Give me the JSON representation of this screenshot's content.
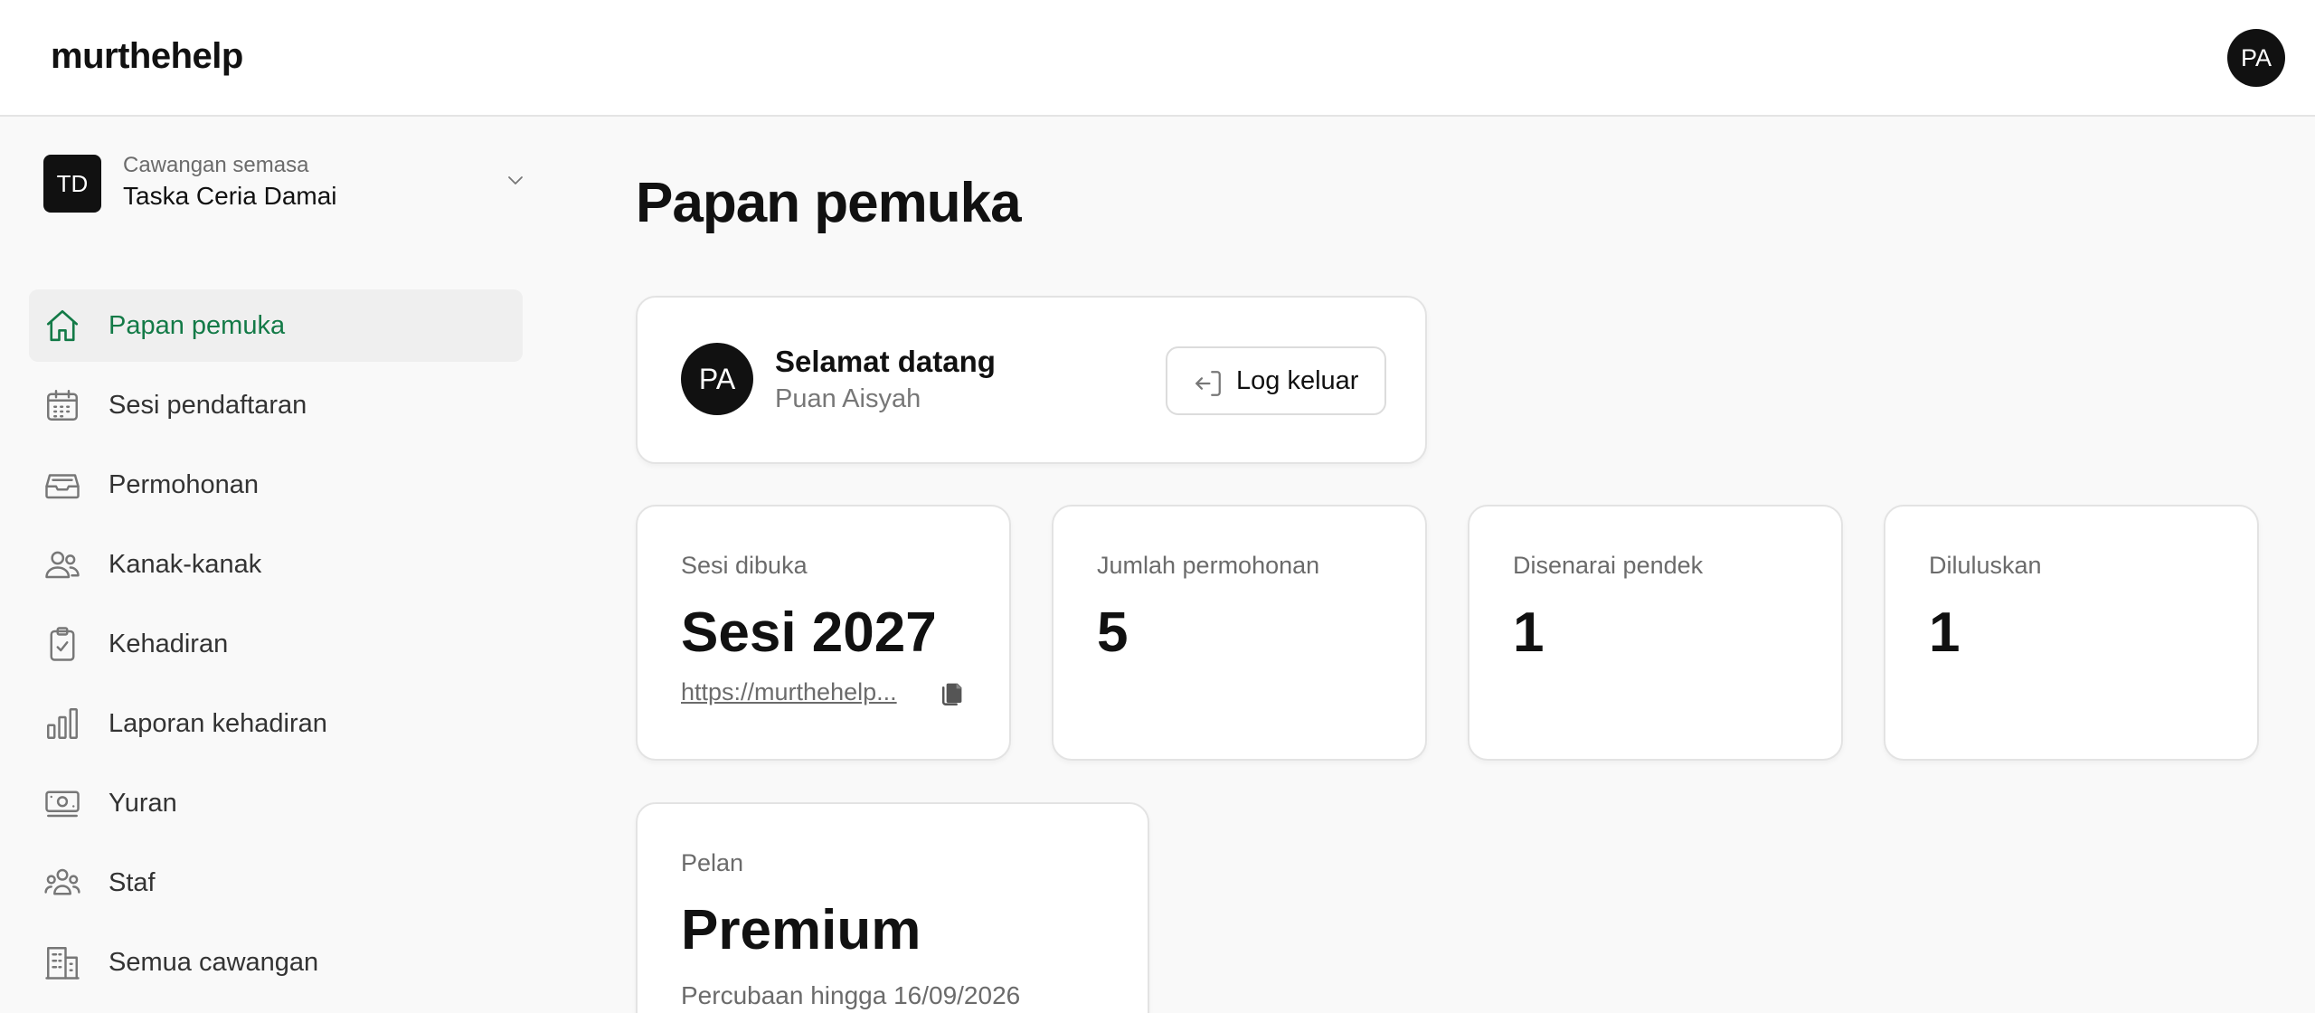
{
  "header": {
    "brand": "murthehelp",
    "avatar_initials": "PA"
  },
  "branch": {
    "badge": "TD",
    "caption": "Cawangan semasa",
    "name": "Taska Ceria Damai"
  },
  "nav": {
    "items": [
      {
        "label": "Papan pemuka",
        "icon": "home-icon",
        "active": true
      },
      {
        "label": "Sesi pendaftaran",
        "icon": "calendar-icon"
      },
      {
        "label": "Permohonan",
        "icon": "inbox-icon"
      },
      {
        "label": "Kanak-kanak",
        "icon": "users-icon"
      },
      {
        "label": "Kehadiran",
        "icon": "clipboard-check-icon"
      },
      {
        "label": "Laporan kehadiran",
        "icon": "bar-chart-icon"
      },
      {
        "label": "Yuran",
        "icon": "banknote-icon"
      },
      {
        "label": "Staf",
        "icon": "user-group-icon"
      },
      {
        "label": "Semua cawangan",
        "icon": "building-icon"
      }
    ]
  },
  "main": {
    "title": "Papan pemuka",
    "welcome": {
      "avatar_initials": "PA",
      "title": "Selamat datang",
      "name": "Puan Aisyah",
      "logout_label": "Log keluar"
    },
    "stats": [
      {
        "label": "Sesi dibuka",
        "value": "Sesi 2027",
        "link": "https://murthehelp..."
      },
      {
        "label": "Jumlah permohonan",
        "value": "5"
      },
      {
        "label": "Disenarai pendek",
        "value": "1"
      },
      {
        "label": "Diluluskan",
        "value": "1"
      }
    ],
    "plan": {
      "label": "Pelan",
      "name": "Premium",
      "trial": "Percubaan hingga 16/09/2026"
    }
  },
  "colors": {
    "accent": "#137a47",
    "background": "#f9f9f9",
    "surface": "#ffffff",
    "text": "#111111",
    "muted": "#6b6b6b"
  }
}
